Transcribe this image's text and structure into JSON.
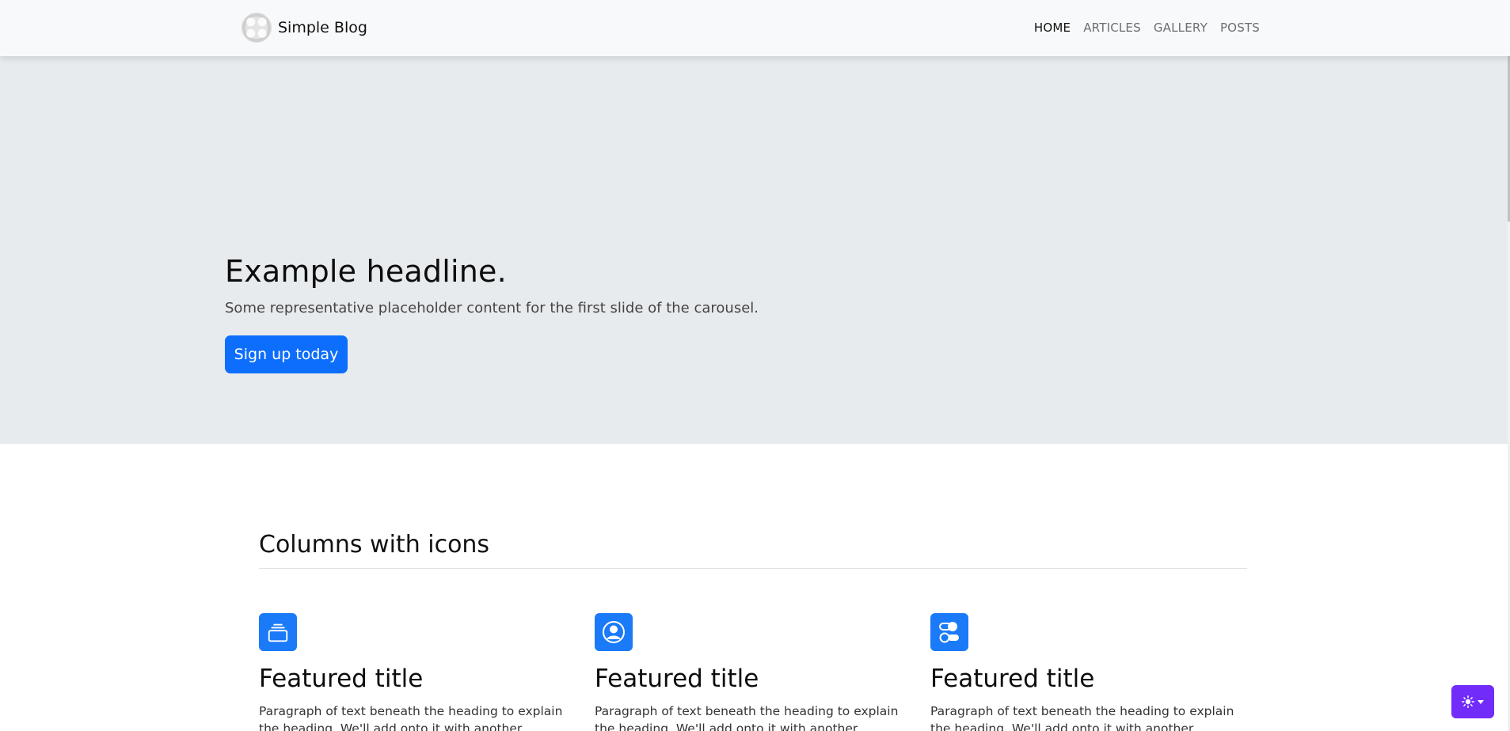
{
  "navbar": {
    "brand": "Simple Blog",
    "links": [
      {
        "label": "HOME",
        "active": true
      },
      {
        "label": "ARTICLES",
        "active": false
      },
      {
        "label": "GALLERY",
        "active": false
      },
      {
        "label": "POSTS",
        "active": false
      }
    ]
  },
  "hero": {
    "headline": "Example headline.",
    "subtext": "Some representative placeholder content for the first slide of the carousel.",
    "button_label": "Sign up today"
  },
  "features": {
    "title": "Columns with icons",
    "items": [
      {
        "icon": "collection-icon",
        "title": "Featured title",
        "text": "Paragraph of text beneath the heading to explain the heading. We'll add onto it with another sentence and"
      },
      {
        "icon": "person-circle-icon",
        "title": "Featured title",
        "text": "Paragraph of text beneath the heading to explain the heading. We'll add onto it with another sentence and"
      },
      {
        "icon": "toggles-icon",
        "title": "Featured title",
        "text": "Paragraph of text beneath the heading to explain the heading. We'll add onto it with another sentence and"
      }
    ]
  },
  "theme_toggle": {
    "icon": "sun-icon"
  },
  "colors": {
    "primary": "#0d6efd",
    "icon_bg": "#1a7af8",
    "toggle": "#712cf9",
    "hero_bg": "#e8ebee",
    "navbar_bg": "#f8f9fa"
  }
}
